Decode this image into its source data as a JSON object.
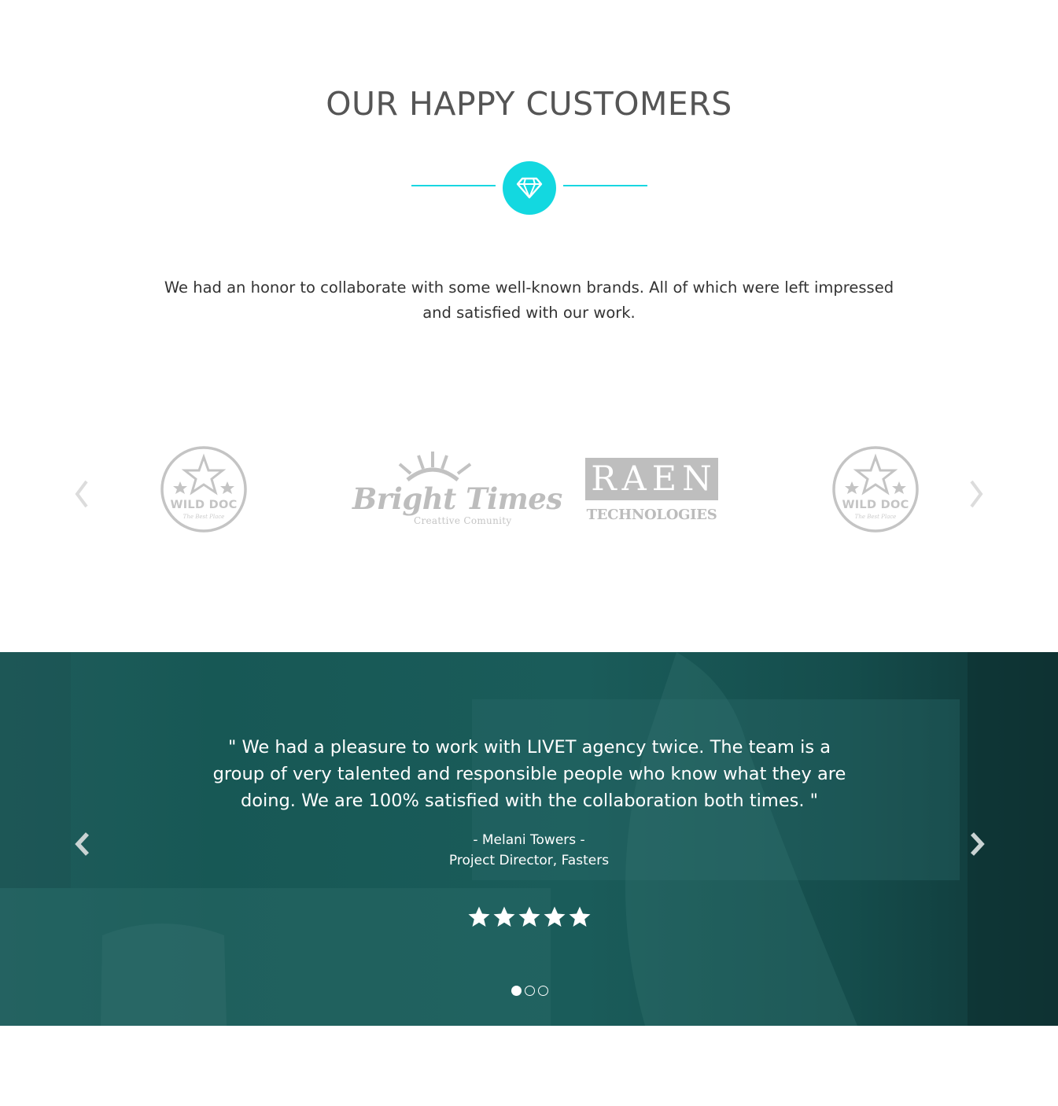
{
  "customers": {
    "title": "OUR HAPPY CUSTOMERS",
    "badge_icon": "diamond-icon",
    "accent_color": "#13d8e0",
    "intro": "We had an honor to collaborate with some well-known brands. All of which were left impressed and satisfied with our work.",
    "logos": [
      {
        "name": "WILD DOC",
        "tagline": "The Best Place"
      },
      {
        "name": "Bright Times",
        "tagline": "Creattive Comunity"
      },
      {
        "name": "RAEN",
        "tagline": "TECHNOLOGIES"
      },
      {
        "name": "WILD DOC",
        "tagline": "The Best Place"
      }
    ],
    "prev_icon": "chevron-left-icon",
    "next_icon": "chevron-right-icon"
  },
  "testimonial": {
    "quote": "\" We had a pleasure to work with LIVET agency twice. The team is a group of very talented and responsible people who know what they are doing. We are 100% satisfied with the collaboration both times. \"",
    "author": "- Melani Towers -",
    "role": "Project Director, Fasters",
    "rating": 5,
    "rating_max": 5,
    "slide_count": 3,
    "active_slide": 1,
    "overlay_color": "#175855"
  }
}
